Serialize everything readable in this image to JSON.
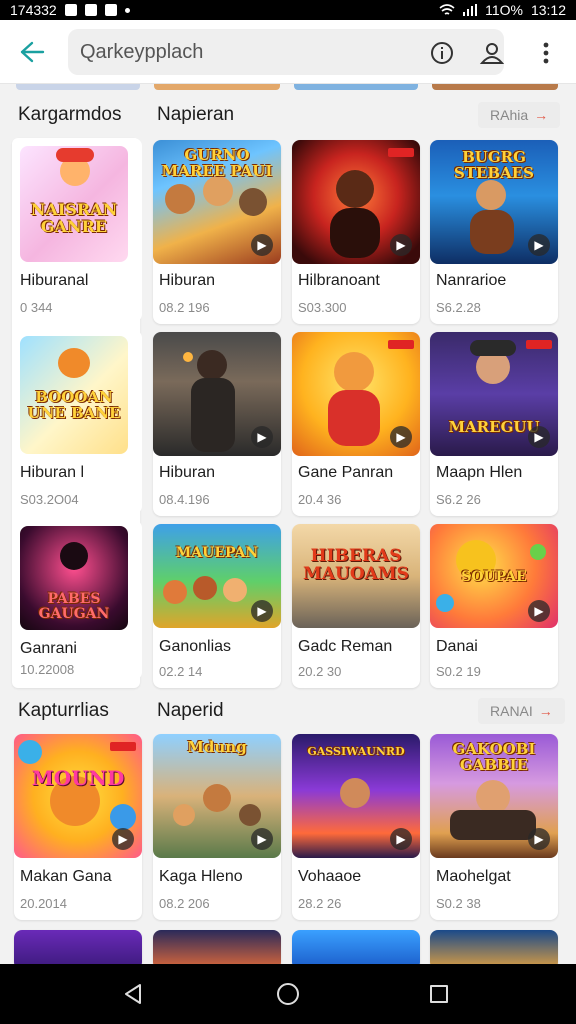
{
  "status_bar": {
    "time_left": "174332",
    "battery": "11O%",
    "time_right": "13:12"
  },
  "search": {
    "query": "Qarkeypplach"
  },
  "colors": {
    "accent": "#1aa0a0",
    "badge": "#e02424",
    "pill_arrow": "#e15a4a"
  },
  "icons": {
    "back": "arrow-left-icon",
    "info": "info-icon",
    "account": "account-icon",
    "more": "more-vert-icon"
  },
  "section1": {
    "left_title": "Kargarmdos",
    "title": "Napieran",
    "pill": "RAhia",
    "side_items": [
      {
        "thumb_title": "NAISRAN GANRE",
        "name": "Hiburanal",
        "meta": "0 344"
      },
      {
        "thumb_title": "BOOOAN UNE BANE",
        "name": "Hiburan l",
        "meta": "S03.2O04"
      },
      {
        "thumb_title": "PABES GAUGAN",
        "name": "Ganrani",
        "meta": "10.22008"
      }
    ],
    "grid": [
      {
        "thumb_title": "GURNO MAREE PAUI",
        "name": "Hiburan",
        "meta": "08.2 196"
      },
      {
        "thumb_title": "",
        "name": "Hilbranoant",
        "meta": "S03.300"
      },
      {
        "thumb_title": "BUGRG STEBAES",
        "name": "Nanrarioe",
        "meta": "S6.2.28"
      },
      {
        "thumb_title": "",
        "name": "Hiburan",
        "meta": "08.4.196"
      },
      {
        "thumb_title": "",
        "name": "Gane Panran",
        "meta": "20.4 36"
      },
      {
        "thumb_title": "MAREGUU",
        "name": "Maapn Hlen",
        "meta": "S6.2 26"
      },
      {
        "thumb_title": "MAUEPAN",
        "name": "Ganonlias",
        "meta": "02.2 14"
      },
      {
        "thumb_title": "HIBERAS MAUOAMS",
        "name": "Gadc Reman",
        "meta": "20.2 30"
      },
      {
        "thumb_title": "SOUPAE",
        "name": "Danai",
        "meta": "S0.2 19"
      }
    ]
  },
  "section2": {
    "left_title": "Kapturrlias",
    "title": "Naperid",
    "pill": "RANAI",
    "grid": [
      {
        "thumb_title": "MOUND",
        "name": "Makan Gana",
        "meta": "20.2014"
      },
      {
        "thumb_title": "Mdung",
        "name": "Kaga Hleno",
        "meta": "08.2 206"
      },
      {
        "thumb_title": "GASSIWAUNRD",
        "name": "Vohaaoe",
        "meta": "28.2 26"
      },
      {
        "thumb_title": "GAKOOBI GABBIE",
        "name": "Maohelgat",
        "meta": "S0.2 38"
      }
    ]
  }
}
